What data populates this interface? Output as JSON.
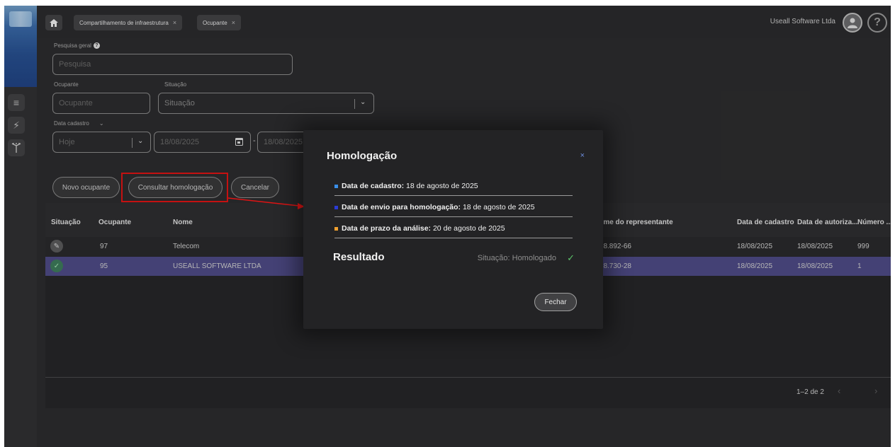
{
  "topbar": {
    "tabs": [
      {
        "label": "Compartilhamento de infraestrutura",
        "close": "×"
      },
      {
        "label": "Ocupante",
        "close": "×"
      }
    ],
    "user_name": "Useall Software Ltda",
    "help_label": "?"
  },
  "filters": {
    "search_label": "Pesquisa geral",
    "search_placeholder": "Pesquisa",
    "ocupante_label": "Ocupante",
    "ocupante_placeholder": "Ocupante",
    "situacao_label": "Situação",
    "situacao_placeholder": "Situação",
    "data_label": "Data cadastro",
    "period_value": "Hoje",
    "date_from": "18/08/2025",
    "date_to": "18/08/2025",
    "date_sep": "-"
  },
  "actions": {
    "novo": "Novo ocupante",
    "consultar": "Consultar homologação",
    "cancelar": "Cancelar"
  },
  "table": {
    "columns": [
      "Situação",
      "Ocupante",
      "Nome",
      "Nome do representante",
      "Data de cadastro",
      "Data de autoriza...",
      "Número ..."
    ],
    "rows": [
      {
        "ocupante": "97",
        "nome": "Telecom",
        "representante": "...778.892-66",
        "cadastro": "18/08/2025",
        "autorizacao": "18/08/2025",
        "numero": "999"
      },
      {
        "ocupante": "95",
        "nome": "USEALL SOFTWARE LTDA",
        "representante": "...338.730-28",
        "cadastro": "18/08/2025",
        "autorizacao": "18/08/2025",
        "numero": "1"
      }
    ],
    "pagination": "1–2 de 2"
  },
  "modal": {
    "title": "Homologação",
    "close_icon": "×",
    "items": [
      {
        "label": "Data de cadastro:",
        "value": "18 de agosto de 2025",
        "color": "#3a8ee8"
      },
      {
        "label": "Data de envio para homologação:",
        "value": "18 de agosto de 2025",
        "color": "#2b3bd6"
      },
      {
        "label": "Data de prazo da análise:",
        "value": "20 de agosto de 2025",
        "color": "#f0a030"
      }
    ],
    "result_title": "Resultado",
    "result_status": "Situação: Homologado",
    "close_button": "Fechar"
  },
  "colors": {
    "selected_row": "#4e4a86",
    "highlight": "#e01414",
    "success": "#5cc46a"
  }
}
